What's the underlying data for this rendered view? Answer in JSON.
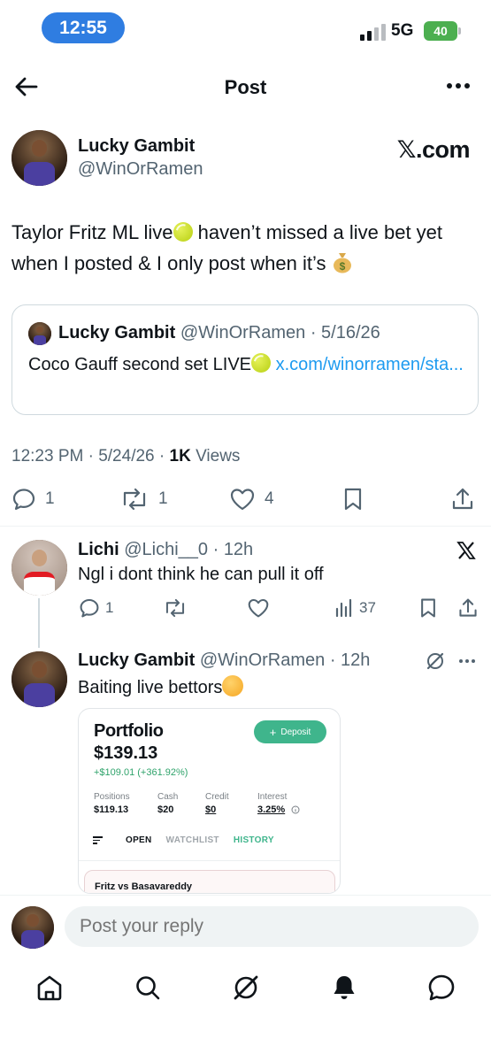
{
  "status_bar": {
    "time": "12:55",
    "network": "5G",
    "battery": "40"
  },
  "header": {
    "title": "Post"
  },
  "main_tweet": {
    "name": "Lucky Gambit",
    "handle": "@WinOrRamen",
    "source_mark": "𝕏.com",
    "text_part1": "Taylor Fritz ML live",
    "text_part2": " haven’t missed a live bet yet when I posted & I only post when it’s ",
    "quote": {
      "name": "Lucky Gambit",
      "meta": "@WinOrRamen · 5/16/26",
      "text": "Coco Gauff second set LIVE",
      "link": "x.com/winorramen/sta..."
    },
    "time": "12:23 PM · 5/24/26 · ",
    "views_count": "1K",
    "views_label": " Views",
    "replies": "1",
    "reposts": "1",
    "likes": "4"
  },
  "reply1": {
    "name": "Lichi",
    "meta": "@Lichi__0 · 12h",
    "text": "Ngl i dont think he can pull it off",
    "replies": "1",
    "views": "37"
  },
  "reply2": {
    "name": "Lucky Gambit",
    "meta": "@WinOrRamen · 12h",
    "text": "Baiting live bettors",
    "portfolio": {
      "title": "Portfolio",
      "value": "$139.13",
      "gain": "+$109.01 (+361.92%)",
      "deposit": "Deposit",
      "stats": [
        {
          "label": "Positions",
          "value": "$119.13"
        },
        {
          "label": "Cash",
          "value": "$20"
        },
        {
          "label": "Credit",
          "value": "$0"
        },
        {
          "label": "Interest",
          "value": "3.25%"
        }
      ],
      "tabs": [
        "OPEN",
        "WATCHLIST",
        "HISTORY"
      ],
      "card_title": "Fritz vs Basavareddy"
    }
  },
  "composer": {
    "placeholder": "Post your reply"
  },
  "colors": {
    "accent": "#1d9bf0",
    "secondary_text": "#536471",
    "time_pill": "#2f7de1",
    "battery": "#4caf50"
  }
}
